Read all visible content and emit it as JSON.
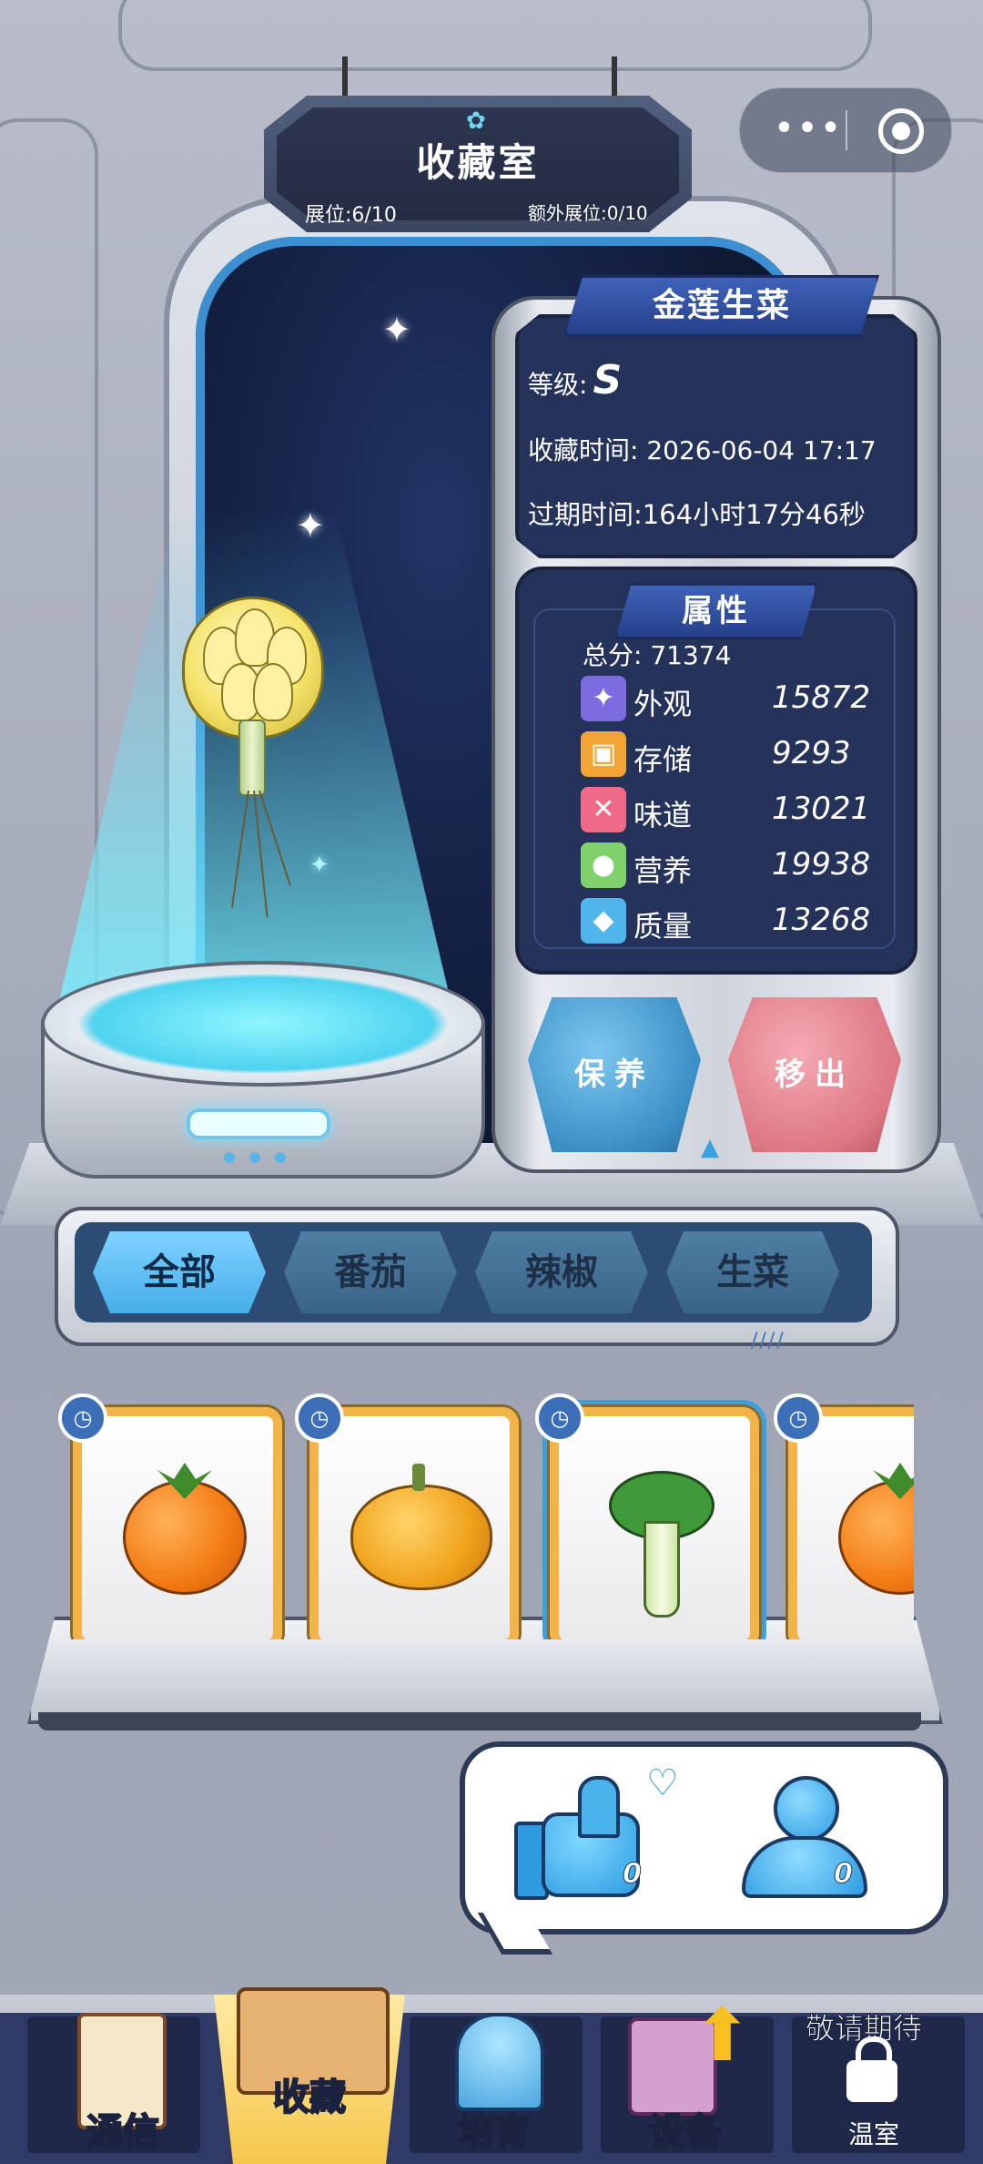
{
  "header": {
    "title": "收藏室",
    "exhibit_slots": "展位:6/10",
    "extra_slots": "额外展位:0/10"
  },
  "capsule": {
    "more_icon": "more-dots-icon",
    "close_icon": "target-icon"
  },
  "item": {
    "name": "金莲生菜",
    "grade_label": "等级:",
    "grade_value": "S",
    "collect_time": "收藏时间: 2026-06-04 17:17",
    "expire_time": "过期时间:164小时17分46秒"
  },
  "attributes": {
    "title": "属性",
    "total": "总分: 71374",
    "rows": [
      {
        "name": "外观",
        "value": "15872",
        "icon": "sparkle-icon",
        "color": "#7d6be0"
      },
      {
        "name": "存储",
        "value": "9293",
        "icon": "box-icon",
        "color": "#f2a534"
      },
      {
        "name": "味道",
        "value": "13021",
        "icon": "utensils-icon",
        "color": "#ee6a86"
      },
      {
        "name": "营养",
        "value": "19938",
        "icon": "fruit-icon",
        "color": "#7fd26a"
      },
      {
        "name": "质量",
        "value": "13268",
        "icon": "muscle-icon",
        "color": "#4fb5ea"
      }
    ]
  },
  "actions": {
    "keep": "保养",
    "remove": "移出"
  },
  "tabs": [
    "全部",
    "番茄",
    "辣椒",
    "生菜"
  ],
  "social": {
    "likes": "0",
    "visitors": "0"
  },
  "nav": {
    "items": [
      "通信",
      "收藏",
      "培育",
      "设备",
      "温室"
    ],
    "coming_soon": "敬请期待"
  },
  "colors": {
    "accent": "#46aee9",
    "card_border": "#f2b449"
  }
}
